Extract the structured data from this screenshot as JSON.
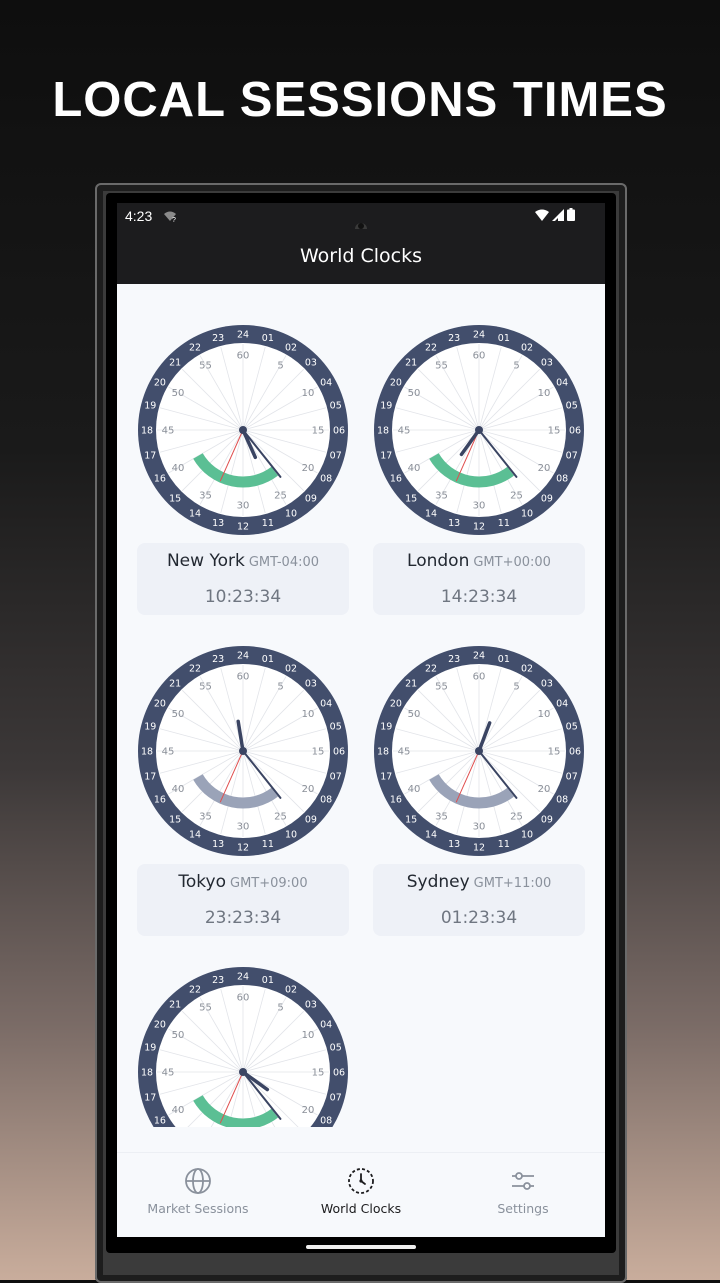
{
  "headline": "LOCAL SESSIONS TIMES",
  "status_bar": {
    "time": "4:23",
    "wifi_question": "?"
  },
  "app_bar": {
    "title": "World Clocks"
  },
  "colors": {
    "ring": "#424e6c",
    "open_session": "#5bbf94",
    "closed_session": "#9aa3b8",
    "second_hand": "#e04e4e",
    "hand": "#3a4462"
  },
  "clock_dial": {
    "outer_numbers": [
      "24",
      "01",
      "02",
      "03",
      "04",
      "05",
      "06",
      "07",
      "08",
      "09",
      "10",
      "11",
      "12",
      "13",
      "14",
      "15",
      "16",
      "17",
      "18",
      "19",
      "20",
      "21",
      "22",
      "23"
    ],
    "inner_numbers": [
      "60",
      "5",
      "10",
      "15",
      "20",
      "25",
      "30",
      "35",
      "40",
      "45",
      "50",
      "55"
    ]
  },
  "clocks": [
    {
      "city": "New York",
      "gmt": "GMT-04:00",
      "time": "10:23:34",
      "hour": 10,
      "minute": 23,
      "second": 34,
      "session_status": "open",
      "session_start_hour": 9.5,
      "session_end_hour": 16
    },
    {
      "city": "London",
      "gmt": "GMT+00:00",
      "time": "14:23:34",
      "hour": 14,
      "minute": 23,
      "second": 34,
      "session_status": "open",
      "session_start_hour": 9.5,
      "session_end_hour": 16
    },
    {
      "city": "Tokyo",
      "gmt": "GMT+09:00",
      "time": "23:23:34",
      "hour": 23,
      "minute": 23,
      "second": 34,
      "session_status": "closed",
      "session_start_hour": 9.5,
      "session_end_hour": 16
    },
    {
      "city": "Sydney",
      "gmt": "GMT+11:00",
      "time": "01:23:34",
      "hour": 1,
      "minute": 23,
      "second": 34,
      "session_status": "closed",
      "session_start_hour": 9.5,
      "session_end_hour": 16
    },
    {
      "city": "",
      "gmt": "",
      "time": "",
      "hour": 8,
      "minute": 23,
      "second": 34,
      "session_status": "open",
      "session_start_hour": 9.5,
      "session_end_hour": 16
    }
  ],
  "nav": {
    "items": [
      {
        "label": "Market Sessions",
        "icon": "globe-icon",
        "active": false
      },
      {
        "label": "World Clocks",
        "icon": "clock-icon",
        "active": true
      },
      {
        "label": "Settings",
        "icon": "sliders-icon",
        "active": false
      }
    ]
  }
}
